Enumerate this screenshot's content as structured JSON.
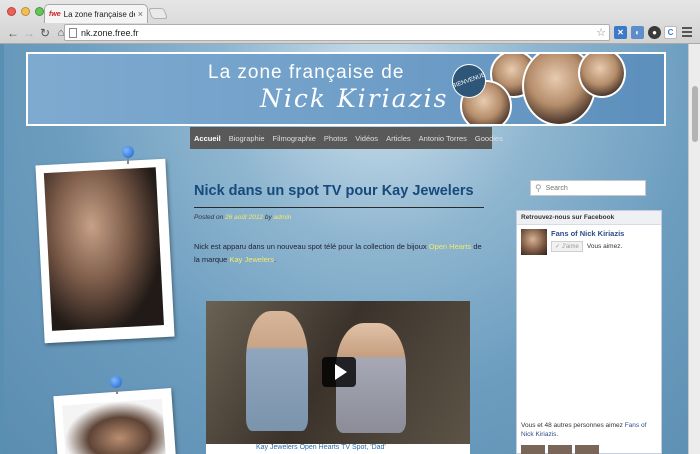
{
  "browser": {
    "tab_title": "La zone française de Nick",
    "tab_favicon": "fwe",
    "url": "nk.zone.free.fr"
  },
  "banner": {
    "line1": "La zone française de",
    "line2": "Nick Kiriazis",
    "badge": "BIENVENUE"
  },
  "nav": {
    "items": [
      {
        "label": "Accueil",
        "active": true
      },
      {
        "label": "Biographie",
        "active": false
      },
      {
        "label": "Filmographie",
        "active": false
      },
      {
        "label": "Photos",
        "active": false
      },
      {
        "label": "Vidéos",
        "active": false
      },
      {
        "label": "Articles",
        "active": false
      },
      {
        "label": "Antonio Torres",
        "active": false
      },
      {
        "label": "Goodies",
        "active": false
      }
    ]
  },
  "post": {
    "title": "Nick dans un spot TV pour Kay Jewelers",
    "meta_prefix": "Posted on",
    "meta_date": "26 août 2012",
    "meta_by": "by",
    "meta_author": "admin",
    "body_1": "Nick est apparu dans un nouveau spot télé pour la collection de bijoux ",
    "body_link1": "Open Hearts",
    "body_2": " de la marque ",
    "body_link2": "Kay Jewelers",
    "body_3": ".",
    "video_caption": "Kay Jewelers Open Hearts TV Spot, 'Dad'"
  },
  "sidebar": {
    "search_placeholder": "Search",
    "facebook": {
      "header": "Retrouvez-nous sur Facebook",
      "page_name": "Fans of Nick Kiriazis",
      "like_label": "J'aime",
      "you_like": "Vous aimez.",
      "footer_text": "Vous et 48 autres personnes aimez ",
      "footer_link": "Fans of Nick Kiriazis",
      "footer_end": "."
    }
  },
  "colors": {
    "accent_link": "#f3e96a",
    "title_blue": "#164a7a",
    "nav_bg": "#595959"
  }
}
